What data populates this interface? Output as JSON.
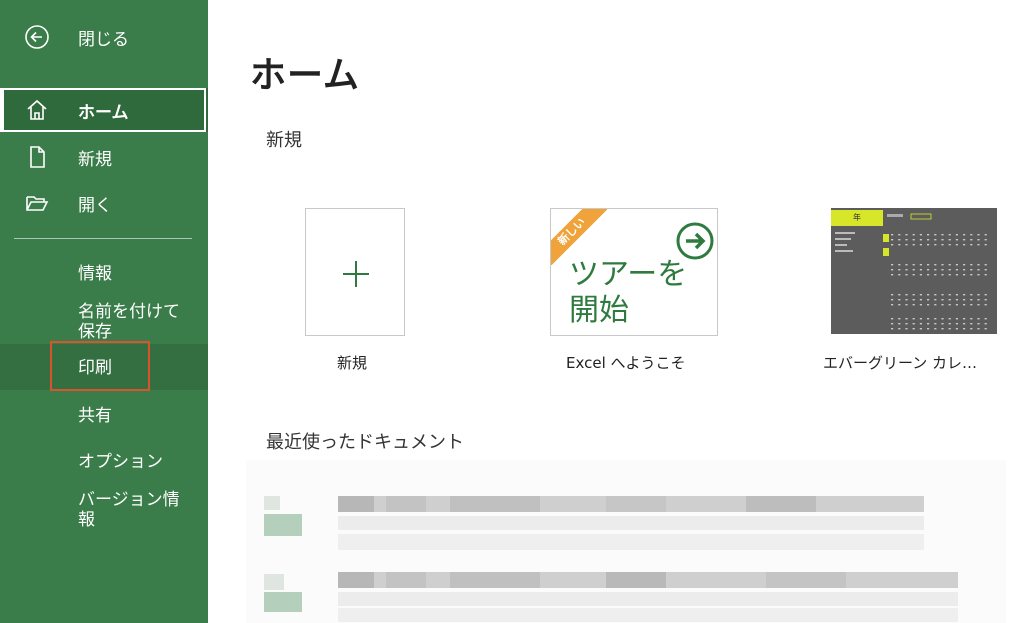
{
  "sidebar": {
    "back_label": "閉じる",
    "items": [
      {
        "label": "ホーム",
        "icon": "home-icon"
      },
      {
        "label": "新規",
        "icon": "new-file-icon"
      },
      {
        "label": "開く",
        "icon": "folder-open-icon"
      }
    ],
    "text_items": [
      "情報",
      "名前を付けて\n保存",
      "印刷",
      "共有",
      "オプション",
      "バージョン情\n報"
    ],
    "save_as_line1": "名前を付けて",
    "save_as_line2": "保存",
    "version_line1": "バージョン情",
    "version_line2": "報",
    "print_highlight_color": "#d9542d"
  },
  "main": {
    "title": "ホーム",
    "new_section_label": "新規",
    "recent_section_label": "最近使ったドキュメント",
    "tiles": [
      {
        "caption": "新規"
      },
      {
        "caption": "Excel へようこそ",
        "badge": "新しい",
        "tour_line1": "ツアーを",
        "tour_line2": "開始"
      },
      {
        "caption": "エバーグリーン カレ…",
        "thumb_title": "年"
      }
    ]
  },
  "colors": {
    "sidebar_bg": "#3b7d4a",
    "accent_green": "#2f7a3f",
    "badge_orange": "#f0a33a"
  }
}
